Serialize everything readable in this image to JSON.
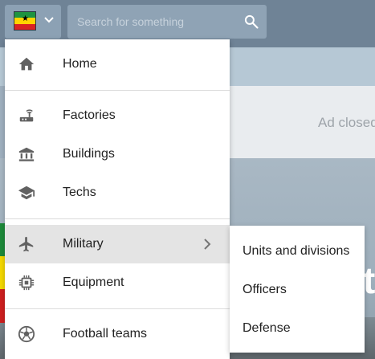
{
  "header": {
    "flag_country_colors": [
      "#1e9440",
      "#ffd400",
      "#d92323"
    ],
    "search_placeholder": "Search for something"
  },
  "ad": {
    "text": "Ad closed"
  },
  "menu": {
    "items": [
      {
        "label": "Home",
        "icon": "home-icon"
      },
      {
        "label": "Factories",
        "icon": "factory-icon"
      },
      {
        "label": "Buildings",
        "icon": "bank-building-icon"
      },
      {
        "label": "Techs",
        "icon": "graduation-cap-icon"
      },
      {
        "label": "Military",
        "icon": "airplane-icon",
        "has_submenu": true,
        "active": true
      },
      {
        "label": "Equipment",
        "icon": "chip-icon"
      },
      {
        "label": "Football teams",
        "icon": "soccer-ball-icon"
      }
    ]
  },
  "submenu": {
    "items": [
      {
        "label": "Units and divisions"
      },
      {
        "label": "Officers"
      },
      {
        "label": "Defense"
      }
    ]
  }
}
